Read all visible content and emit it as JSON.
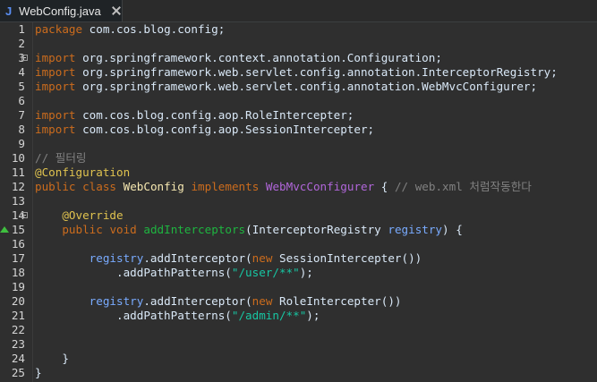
{
  "tab": {
    "icon": "J",
    "label": "WebConfig.java"
  },
  "gutter": {
    "numbers": [
      "1",
      "2",
      "3",
      "4",
      "5",
      "6",
      "7",
      "8",
      "9",
      "10",
      "11",
      "12",
      "13",
      "14",
      "15",
      "16",
      "17",
      "18",
      "19",
      "20",
      "21",
      "22",
      "23",
      "24",
      "25"
    ]
  },
  "code": {
    "l1": [
      "package",
      " com.cos.blog.config;"
    ],
    "l3": [
      "import",
      " org.springframework.context.annotation.Configuration;"
    ],
    "l4": [
      "import",
      " org.springframework.web.servlet.config.annotation.InterceptorRegistry;"
    ],
    "l5": [
      "import",
      " org.springframework.web.servlet.config.annotation.WebMvcConfigurer;"
    ],
    "l7": [
      "import",
      " com.cos.blog.config.aop.RoleIntercepter;"
    ],
    "l8": [
      "import",
      " com.cos.blog.config.aop.SessionIntercepter;"
    ],
    "l10": [
      "// 필터링"
    ],
    "l11": [
      "@Configuration"
    ],
    "l12": [
      "public",
      " ",
      "class",
      " ",
      "WebConfig",
      " ",
      "implements",
      " ",
      "WebMvcConfigurer",
      " { ",
      "// web.xml 처럼작동한다"
    ],
    "l14": [
      "    ",
      "@Override"
    ],
    "l15": [
      "    ",
      "public",
      " ",
      "void",
      " ",
      "addInterceptors",
      "(",
      "InterceptorRegistry",
      " ",
      "registry",
      ") {"
    ],
    "l17": [
      "        ",
      "registry",
      ".addInterceptor(",
      "new",
      " SessionIntercepter())"
    ],
    "l18": [
      "            .addPathPatterns(",
      "\"/user/**\"",
      ");"
    ],
    "l20": [
      "        ",
      "registry",
      ".addInterceptor(",
      "new",
      " RoleIntercepter())"
    ],
    "l21": [
      "            .addPathPatterns(",
      "\"/admin/**\"",
      ");"
    ],
    "l24": [
      "    }"
    ],
    "l25": [
      "}"
    ]
  },
  "colors": {
    "keyword": "#cc6c1d",
    "annotation": "#e0c34f",
    "method_declaration": "#1eb540",
    "parameter": "#79abff",
    "string": "#17c6a3",
    "comment": "#808080",
    "interface": "#b166da",
    "background": "#2f2f2f"
  }
}
